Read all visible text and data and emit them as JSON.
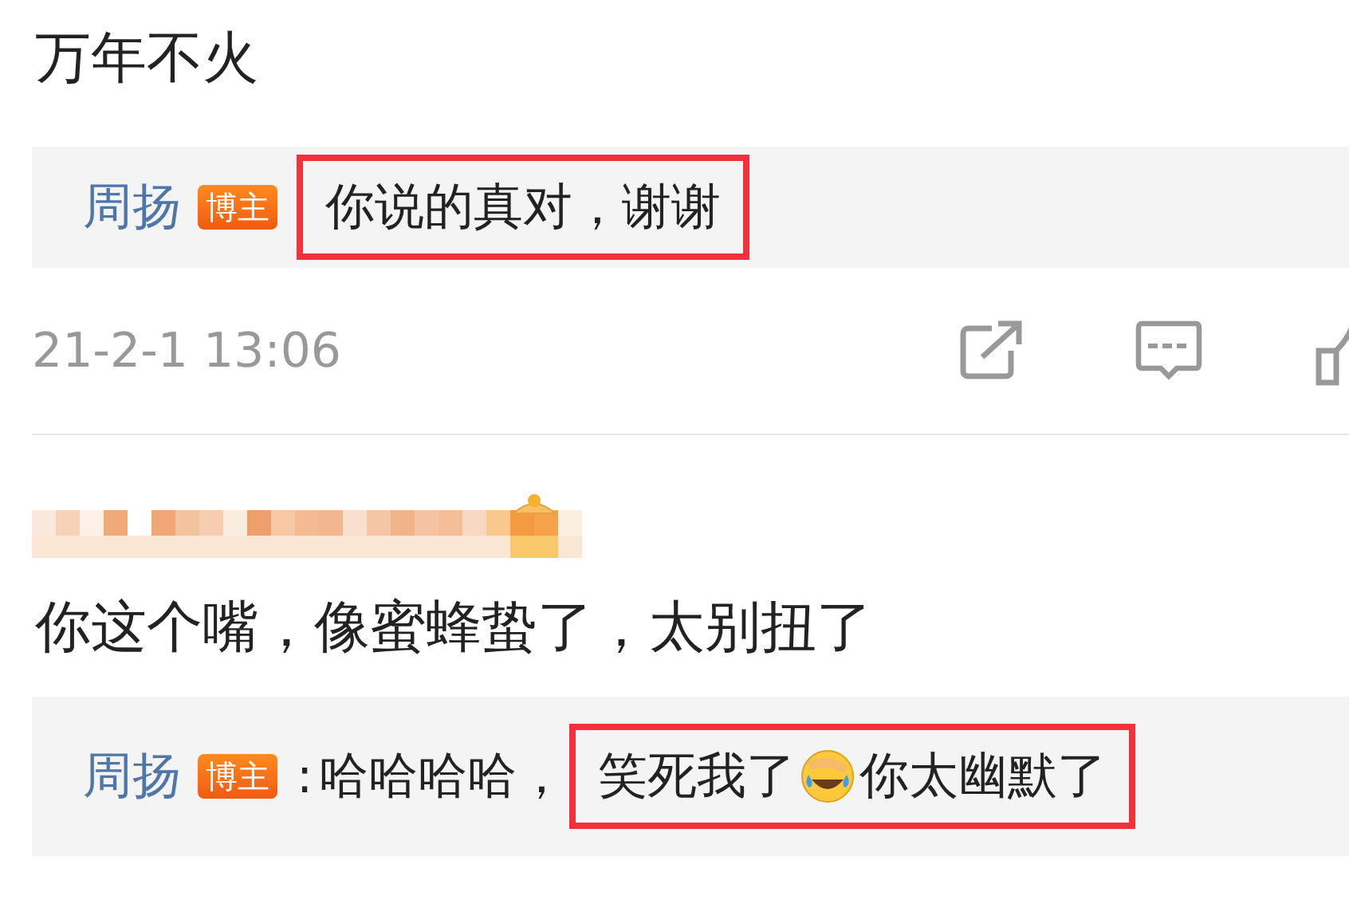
{
  "comments": [
    {
      "kind": "partial",
      "text": "万年不火",
      "reply": {
        "author": "周扬",
        "badge": "博主",
        "spans": [
          {
            "highlighted": true,
            "parts": [
              {
                "kind": "text",
                "text": "你说的真对，谢谢"
              }
            ]
          }
        ]
      },
      "time": "21-2-1 13:06"
    },
    {
      "kind": "full",
      "text": "你这个嘴，像蜜蜂蛰了，太别扭了",
      "reply": {
        "author": "周扬",
        "badge": "博主",
        "separator": ":",
        "spans": [
          {
            "highlighted": false,
            "parts": [
              {
                "kind": "text",
                "text": "哈哈哈哈，"
              }
            ]
          },
          {
            "highlighted": true,
            "parts": [
              {
                "kind": "text",
                "text": "笑死我了"
              },
              {
                "kind": "emoji"
              },
              {
                "kind": "text",
                "text": "你太幽默了"
              }
            ]
          }
        ]
      }
    }
  ]
}
